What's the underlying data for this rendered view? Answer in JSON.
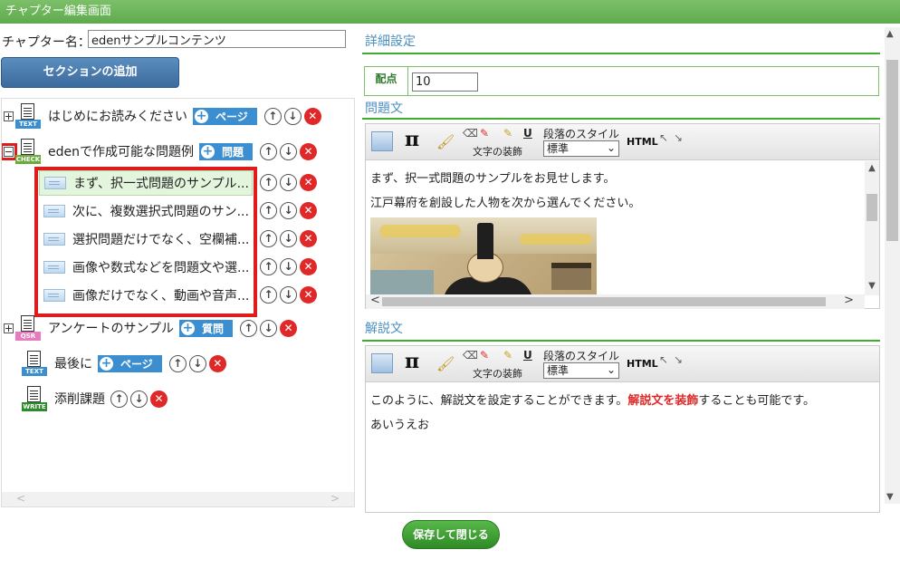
{
  "window": {
    "title": "チャプター編集画面"
  },
  "chapter": {
    "label": "チャプター名：",
    "name": "edenサンプルコンテンツ"
  },
  "add_section_label": "セクションの追加",
  "tree": {
    "nodes": [
      {
        "label": "はじめにお読みください",
        "tag": "TEXT",
        "button": "ページ"
      },
      {
        "label": "edenで作成可能な問題例",
        "tag": "CHECK",
        "button": "問題"
      },
      {
        "label": "アンケートのサンプル",
        "tag": "QSR",
        "button": "質問"
      },
      {
        "label": "最後に",
        "tag": "TEXT",
        "button": "ページ"
      },
      {
        "label": "添削課題",
        "tag": "WRITE"
      }
    ],
    "questions": [
      "まず、択一式問題のサンプル...",
      "次に、複数選択式問題のサン...",
      "選択問題だけでなく、空欄補...",
      "画像や数式などを問題文や選...",
      "画像だけでなく、動画や音声..."
    ]
  },
  "details": {
    "heading": "詳細設定",
    "score_label": "配点",
    "score_value": "10"
  },
  "toolbar": {
    "decoration_label": "文字の装飾",
    "paragraph_label": "段落のスタイル",
    "paragraph_value": "標準",
    "html_label": "HTML",
    "underline": "U"
  },
  "question_editor": {
    "heading": "問題文",
    "line1": "まず、択一式問題のサンプルをお見せします。",
    "line2": "江戸幕府を創設した人物を次から選んでください。"
  },
  "explanation_editor": {
    "heading": "解説文",
    "line1_before": "このように、解説文を設定することができます。",
    "line1_highlight": "解説文を装飾",
    "line1_after": "することも可能です。",
    "line2": "あいうえお"
  },
  "save_label": "保存して閉じる",
  "colors": {
    "accent_green": "#5eaa4d",
    "tag_blue": "#3b8fd0",
    "delete_red": "#e02828",
    "highlight_red": "#e01b1b"
  }
}
